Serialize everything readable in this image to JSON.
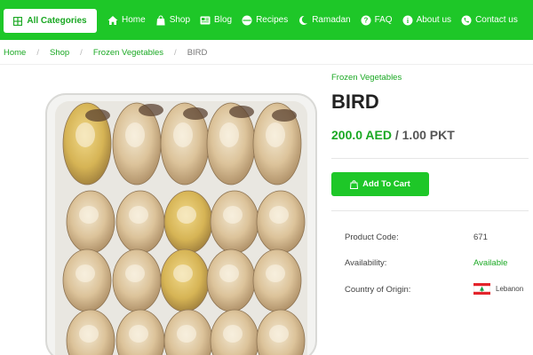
{
  "nav": {
    "categories_label": "All Categories",
    "items": [
      {
        "label": "Home",
        "icon": "home-icon"
      },
      {
        "label": "Shop",
        "icon": "shopping-bag-icon"
      },
      {
        "label": "Blog",
        "icon": "newspaper-icon"
      },
      {
        "label": "Recipes",
        "icon": "dish-icon"
      },
      {
        "label": "Ramadan",
        "icon": "crescent-moon-icon"
      },
      {
        "label": "FAQ",
        "icon": "question-circle-icon"
      },
      {
        "label": "About us",
        "icon": "info-circle-icon"
      },
      {
        "label": "Contact us",
        "icon": "phone-icon"
      }
    ]
  },
  "breadcrumb": {
    "items": [
      "Home",
      "Shop",
      "Frozen Vegetables"
    ],
    "current": "BIRD"
  },
  "product": {
    "category": "Frozen Vegetables",
    "title": "BIRD",
    "price": "200.0 AED",
    "unit": "/ 1.00 PKT",
    "add_to_cart_label": "Add To Cart",
    "details": {
      "code_label": "Product Code:",
      "code_value": "671",
      "availability_label": "Availability:",
      "availability_value": "Available",
      "origin_label": "Country of Origin:",
      "origin_value": "Lebanon"
    }
  },
  "colors": {
    "brand_green": "#1ec728",
    "link_green": "#1aa823"
  }
}
